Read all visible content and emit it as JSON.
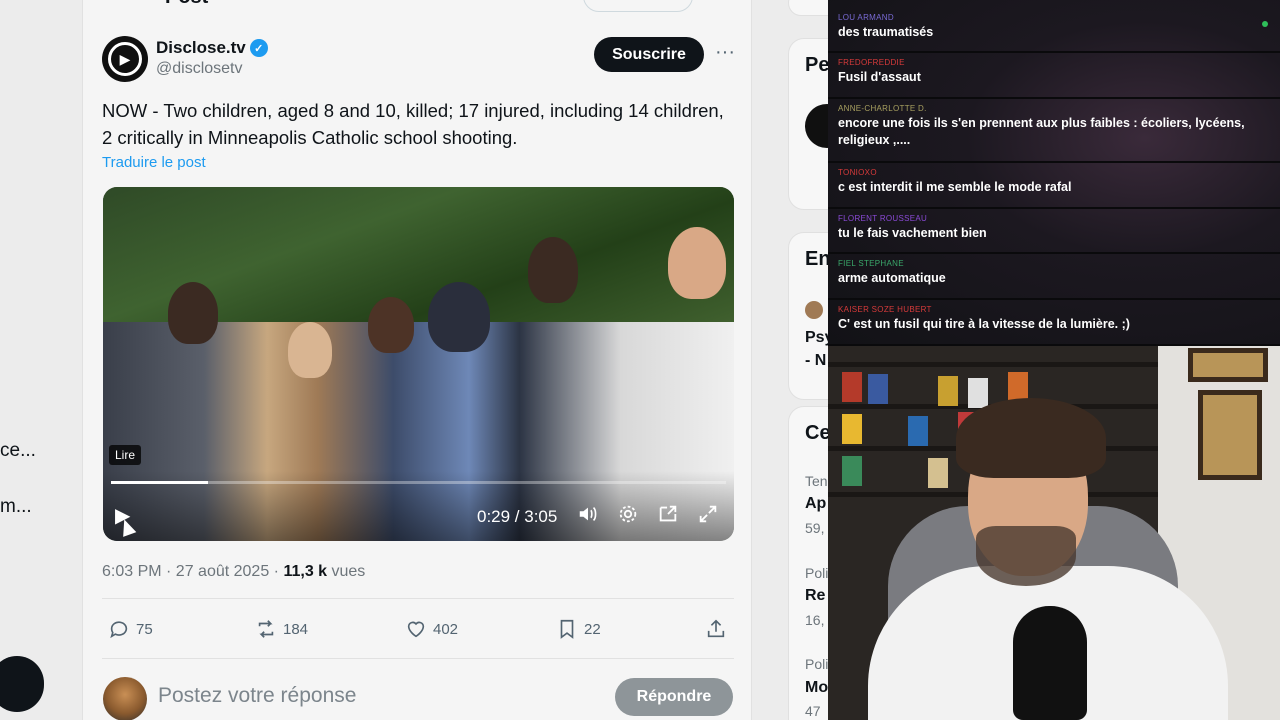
{
  "left_nav": {
    "frag1": "ce...",
    "frag2": "m..."
  },
  "header": {
    "title_fragment": "Post"
  },
  "post": {
    "author_name": "Disclose.tv",
    "author_handle": "@disclosetv",
    "subscribe_label": "Souscrire",
    "more_label": "···",
    "text": "NOW - Two children, aged 8 and 10, killed; 17 injured, including 14 children, 2 critically in Minneapolis Catholic school shooting.",
    "translate_label": "Traduire le post",
    "video": {
      "tooltip": "Lire",
      "time": "0:29 / 3:05",
      "progress": 0.157
    },
    "timestamp": "6:03 PM · 27 août 2025 · ",
    "views_count": "11,3 k",
    "views_label": " vues",
    "stats": {
      "replies": "75",
      "reposts": "184",
      "likes": "402",
      "bookmarks": "22"
    }
  },
  "reply": {
    "placeholder": "Postez votre réponse",
    "button_label": "Répondre"
  },
  "sidebar": {
    "frag_pe": "Pe",
    "frag_en": "En",
    "frag_psy": "Psy",
    "frag_n": "- N",
    "frag_ce": "Ce",
    "frag_ter": "Ten",
    "frag_ap": "Ap",
    "frag_59": "59,",
    "frag_pol1": "Poli",
    "frag_re": "Re",
    "frag_16": "16,",
    "frag_pol2": "Poli",
    "frag_mo": "Mo",
    "frag_47": "47"
  },
  "chat": {
    "messages": [
      {
        "user": "LOU ARMAND",
        "color": "#7a6bd6",
        "text": "des traumatisés"
      },
      {
        "user": "FREDOFREDDIE",
        "color": "#d63a3a",
        "text": "Fusil d'assaut"
      },
      {
        "user": "ANNE-CHARLOTTE D.",
        "color": "#a8a060",
        "text": "encore une fois ils s'en prennent aux plus faibles : écoliers, lycéens, religieux ,...."
      },
      {
        "user": "TONIOXO",
        "color": "#d63a3a",
        "text": "c est interdit il me semble le mode rafal"
      },
      {
        "user": "FLORENT ROUSSEAU",
        "color": "#8a4ad6",
        "text": "tu le fais vachement bien"
      },
      {
        "user": "FIEL STEPHANE",
        "color": "#3aa86a",
        "text": "arme automatique"
      },
      {
        "user": "KAISER SOZE HUBERT",
        "color": "#d63a3a",
        "text": "C' est un fusil qui tire à la vitesse de la lumière. ;)"
      }
    ]
  },
  "colors": {
    "accent": "#1d9bf0",
    "dark_button": "#0f1419",
    "disabled_button": "#8e9599"
  }
}
